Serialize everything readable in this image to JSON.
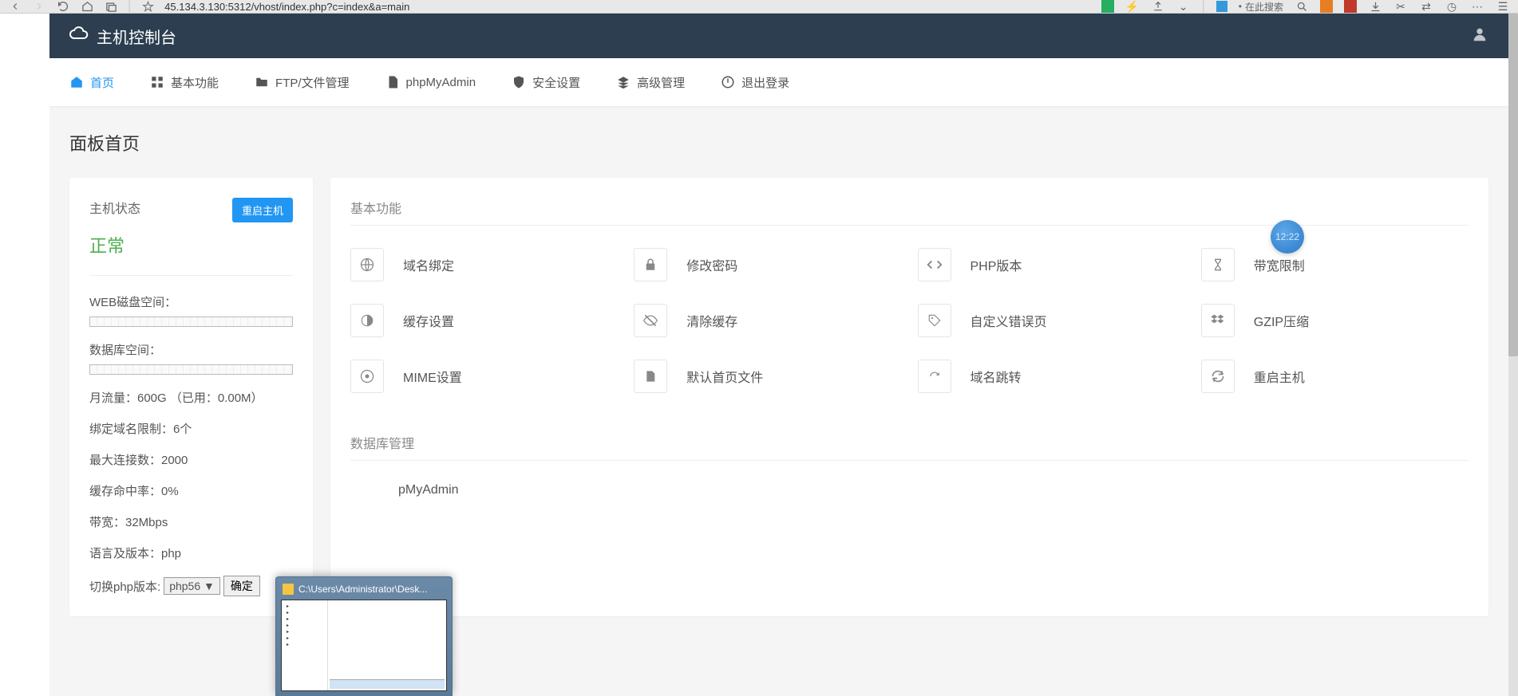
{
  "browser": {
    "url": "45.134.3.130:5312/vhost/index.php?c=index&a=main",
    "search_placeholder": "在此搜索"
  },
  "header": {
    "title": "主机控制台"
  },
  "nav": {
    "items": [
      {
        "label": "首页"
      },
      {
        "label": "基本功能"
      },
      {
        "label": "FTP/文件管理"
      },
      {
        "label": "phpMyAdmin"
      },
      {
        "label": "安全设置"
      },
      {
        "label": "高级管理"
      },
      {
        "label": "退出登录"
      }
    ]
  },
  "page": {
    "title": "面板首页"
  },
  "status": {
    "label": "主机状态",
    "restart_btn": "重启主机",
    "value": "正常",
    "disk_label": "WEB磁盘空间：",
    "db_label": "数据库空间：",
    "monthly": "月流量：600G  （已用：0.00M）",
    "domain_limit": "绑定域名限制：6个",
    "max_conn": "最大连接数：2000",
    "cache_hit": "缓存命中率：0%",
    "bandwidth": "带宽：32Mbps",
    "lang": "语言及版本：php",
    "switch_label": "切换php版本:",
    "php_selected": "php56 ▼",
    "confirm": "确定"
  },
  "features": {
    "title": "基本功能",
    "items": [
      {
        "label": "域名绑定"
      },
      {
        "label": "修改密码"
      },
      {
        "label": "PHP版本"
      },
      {
        "label": "带宽限制"
      },
      {
        "label": "缓存设置"
      },
      {
        "label": "清除缓存"
      },
      {
        "label": "自定义错误页"
      },
      {
        "label": "GZIP压缩"
      },
      {
        "label": "MIME设置"
      },
      {
        "label": "默认首页文件"
      },
      {
        "label": "域名跳转"
      },
      {
        "label": "重启主机"
      }
    ]
  },
  "db_section": {
    "title": "数据库管理",
    "item": "pMyAdmin"
  },
  "preview": {
    "title": "C:\\Users\\Administrator\\Desk..."
  },
  "clock": {
    "time": "12:22"
  }
}
